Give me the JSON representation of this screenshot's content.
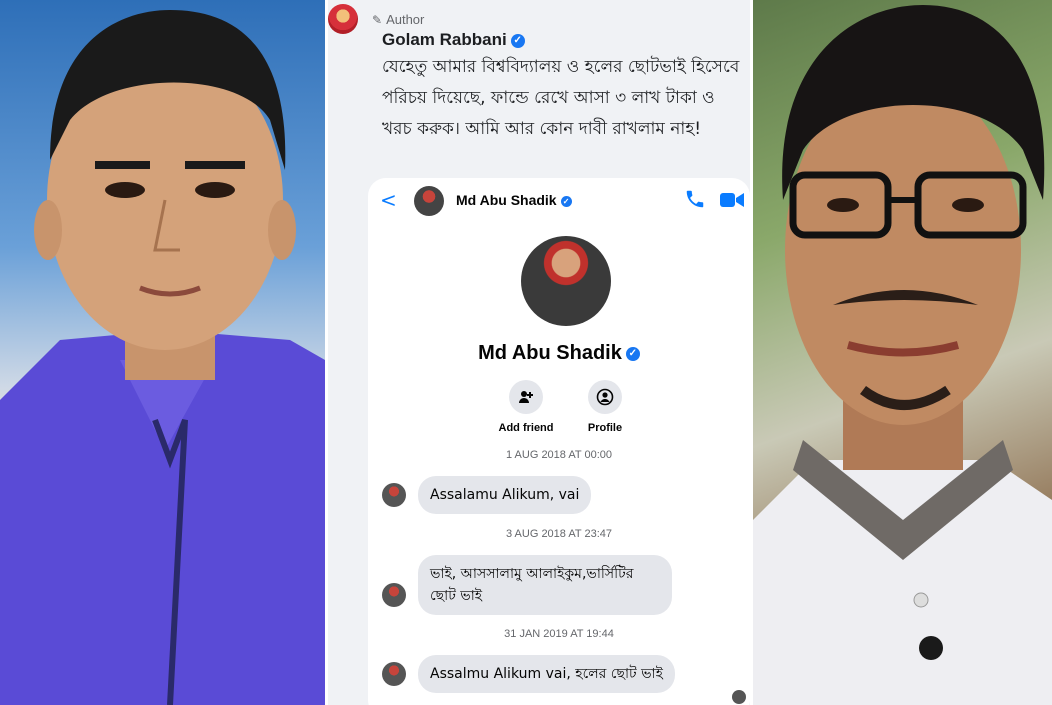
{
  "post": {
    "author_badge": "Author",
    "author_name": "Golam Rabbani",
    "comment_text": "যেহেতু আমার বিশ্ববিদ্যালয় ও হলের ছোটভাই হিসেবে পরিচয় দিয়েছে, ফান্ডে রেখে আসা ৩ লাখ টাকা ও খরচ করুক। আমি আর কোন দাবী রাখলাম নাহ!"
  },
  "messenger": {
    "contact_name": "Md Abu Shadik",
    "actions": [
      {
        "label": "Add friend",
        "icon": "add-friend-icon"
      },
      {
        "label": "Profile",
        "icon": "profile-icon"
      }
    ],
    "messages": [
      {
        "timestamp": "1 AUG 2018 AT 00:00",
        "text": "Assalamu Alikum, vai"
      },
      {
        "timestamp": "3 AUG 2018 AT 23:47",
        "text": "ভাই, আসসালামু আলাইকুম,ভার্সিটির ছোট ভাই"
      },
      {
        "timestamp": "31 JAN 2019 AT 19:44",
        "text": "Assalmu Alikum vai, হলের ছোট ভাই"
      }
    ]
  },
  "colors": {
    "messenger_blue": "#0a7cff",
    "verified_blue": "#1877f2",
    "bubble_gray": "#e4e6eb"
  }
}
